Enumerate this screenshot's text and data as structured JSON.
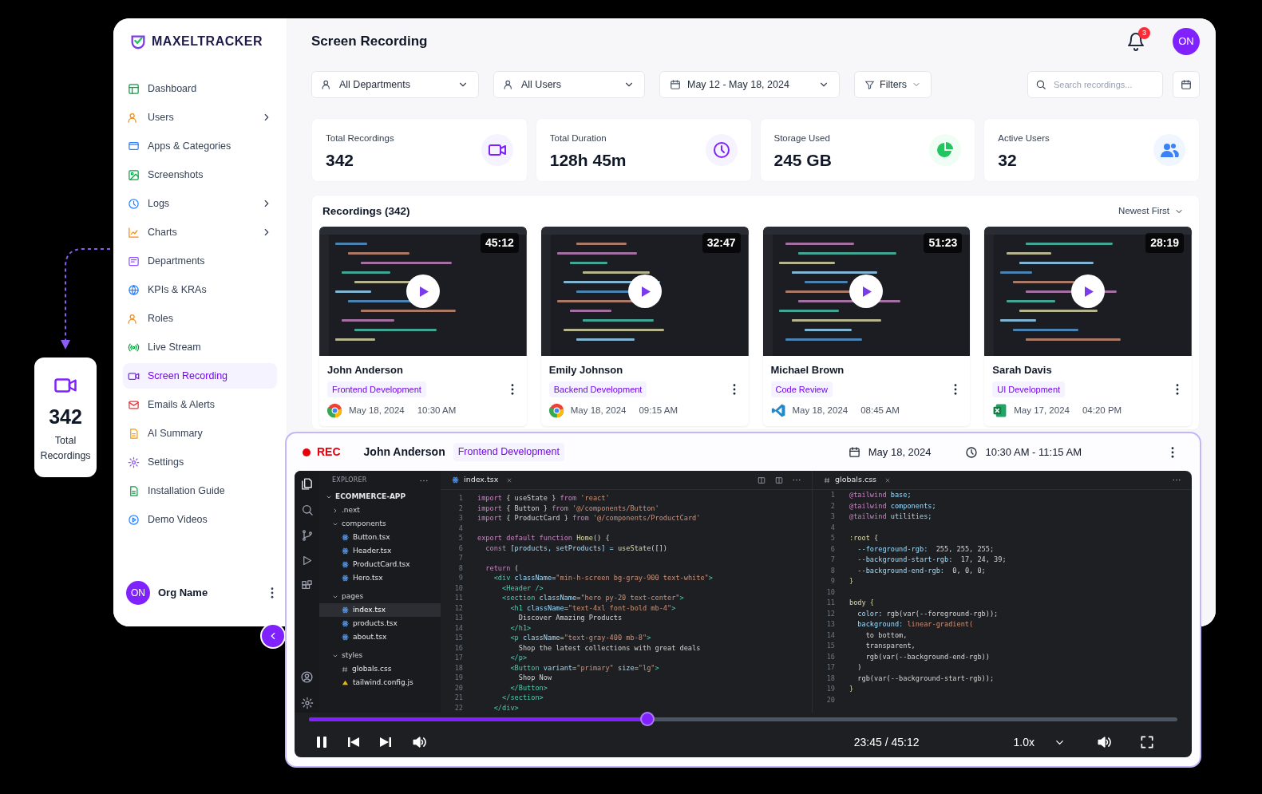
{
  "brand": "MAXELTRACKER",
  "sidebar": {
    "items": [
      {
        "label": "Dashboard",
        "has_submenu": false,
        "selected": false
      },
      {
        "label": "Users",
        "has_submenu": true,
        "selected": false
      },
      {
        "label": "Apps & Categories",
        "has_submenu": false,
        "selected": false
      },
      {
        "label": "Screenshots",
        "has_submenu": false,
        "selected": false
      },
      {
        "label": "Logs",
        "has_submenu": true,
        "selected": false
      },
      {
        "label": "Charts",
        "has_submenu": true,
        "selected": false
      },
      {
        "label": "Departments",
        "has_submenu": false,
        "selected": false
      },
      {
        "label": "KPIs & KRAs",
        "has_submenu": false,
        "selected": false
      },
      {
        "label": "Roles",
        "has_submenu": false,
        "selected": false
      },
      {
        "label": "Live Stream",
        "has_submenu": false,
        "selected": false
      },
      {
        "label": "Screen Recording",
        "has_submenu": false,
        "selected": true
      },
      {
        "label": "Emails & Alerts",
        "has_submenu": false,
        "selected": false
      },
      {
        "label": "AI Summary",
        "has_submenu": false,
        "selected": false
      },
      {
        "label": "Settings",
        "has_submenu": false,
        "selected": false
      },
      {
        "label": "Installation Guide",
        "has_submenu": false,
        "selected": false
      },
      {
        "label": "Demo Videos",
        "has_submenu": false,
        "selected": false
      }
    ],
    "org": {
      "initials": "ON",
      "name": "Org Name"
    }
  },
  "header": {
    "title": "Screen Recording",
    "notifications": "3",
    "avatar": "ON"
  },
  "filters": {
    "department": "All Departments",
    "user": "All Users",
    "date_range": "May 12 - May 18, 2024",
    "filters": "Filters",
    "search": {
      "placeholder": "Search recordings..."
    }
  },
  "stats": [
    {
      "label": "Total Recordings",
      "value": "342"
    },
    {
      "label": "Total Duration",
      "value": "128h 45m"
    },
    {
      "label": "Storage Used",
      "value": "245 GB"
    },
    {
      "label": "Active Users",
      "value": "32"
    }
  ],
  "recordings": {
    "title": "Recordings (342)",
    "sort": "Newest First",
    "items": [
      {
        "duration": "45:12",
        "name": "John Anderson",
        "tag": "Frontend Development",
        "date": "May 18, 2024",
        "time": "10:30 AM"
      },
      {
        "duration": "32:47",
        "name": "Emily Johnson",
        "tag": "Backend Development",
        "date": "May 18, 2024",
        "time": "09:15 AM"
      },
      {
        "duration": "51:23",
        "name": "Michael Brown",
        "tag": "Code Review",
        "date": "May 18, 2024",
        "time": "08:45 AM"
      },
      {
        "duration": "28:19",
        "name": "Sarah Davis",
        "tag": "UI Development",
        "date": "May 17, 2024",
        "time": "04:20 PM"
      }
    ]
  },
  "player": {
    "rec": "REC",
    "name": "John Anderson",
    "tag": "Frontend Development",
    "date": "May 18, 2024",
    "time_range": "10:30 AM - 11:15 AM",
    "explorer": {
      "title": "EXPLORER",
      "tree": [
        {
          "label": "ECOMMERCE-APP",
          "kind": "root",
          "expanded": true,
          "children": [
            {
              "label": ".next",
              "kind": "folder",
              "expanded": false
            },
            {
              "label": "components",
              "kind": "folder",
              "expanded": true,
              "children": [
                {
                  "label": "Button.tsx",
                  "kind": "tsx",
                  "selected": false
                },
                {
                  "label": "Header.tsx",
                  "kind": "tsx",
                  "selected": false
                },
                {
                  "label": "ProductCard.tsx",
                  "kind": "tsx",
                  "selected": false
                },
                {
                  "label": "Hero.tsx",
                  "kind": "tsx",
                  "selected": false
                }
              ]
            },
            {
              "label": "pages",
              "kind": "folder",
              "expanded": true,
              "children": [
                {
                  "label": "index.tsx",
                  "kind": "tsx",
                  "selected": true
                },
                {
                  "label": "products.tsx",
                  "kind": "tsx",
                  "selected": false
                },
                {
                  "label": "about.tsx",
                  "kind": "tsx",
                  "selected": false
                }
              ]
            },
            {
              "label": "styles",
              "kind": "folder",
              "expanded": true,
              "children": [
                {
                  "label": "globals.css",
                  "kind": "css",
                  "selected": false
                },
                {
                  "label": "tailwind.config.js",
                  "kind": "js",
                  "selected": false
                }
              ]
            }
          ]
        }
      ]
    },
    "panes": [
      {
        "tab": "index.tsx",
        "lines": [
          {
            "number": "1",
            "tokens": [
              {
                "text": "import ",
                "kind": "kw"
              },
              {
                "text": "{ useState } ",
                "kind": "tx"
              },
              {
                "text": "from ",
                "kind": "kw"
              },
              {
                "text": "'react'",
                "kind": "str"
              }
            ]
          },
          {
            "number": "2",
            "tokens": [
              {
                "text": "import ",
                "kind": "kw"
              },
              {
                "text": "{ Button } ",
                "kind": "tx"
              },
              {
                "text": "from ",
                "kind": "kw"
              },
              {
                "text": "'@/components/Button'",
                "kind": "str"
              }
            ]
          },
          {
            "number": "3",
            "tokens": [
              {
                "text": "import ",
                "kind": "kw"
              },
              {
                "text": "{ ProductCard } ",
                "kind": "tx"
              },
              {
                "text": "from ",
                "kind": "kw"
              },
              {
                "text": "'@/components/ProductCard'",
                "kind": "str"
              }
            ]
          },
          {
            "number": "4"
          },
          {
            "number": "5",
            "tokens": [
              {
                "text": "export default function ",
                "kind": "kw"
              },
              {
                "text": "Home",
                "kind": "fn"
              },
              {
                "text": "() {",
                "kind": "tx"
              }
            ]
          },
          {
            "number": "6",
            "tokens": [
              {
                "text": "  const ",
                "kind": "kw"
              },
              {
                "text": "[products, setProducts] = ",
                "kind": "attr"
              },
              {
                "text": "useState",
                "kind": "fn"
              },
              {
                "text": "([])",
                "kind": "tx"
              }
            ]
          },
          {
            "number": "7"
          },
          {
            "number": "8",
            "tokens": [
              {
                "text": "  return ",
                "kind": "kw"
              },
              {
                "text": "(",
                "kind": "tx"
              }
            ]
          },
          {
            "number": "9",
            "tokens": [
              {
                "text": "    <div ",
                "kind": "tag"
              },
              {
                "text": "className",
                "kind": "attr"
              },
              {
                "text": "=",
                "kind": "tx"
              },
              {
                "text": "\"min-h-screen bg-gray-900 text-white\"",
                "kind": "str"
              },
              {
                "text": ">",
                "kind": "tag"
              }
            ]
          },
          {
            "number": "10",
            "tokens": [
              {
                "text": "      <Header />",
                "kind": "tag"
              }
            ]
          },
          {
            "number": "11",
            "tokens": [
              {
                "text": "      <section ",
                "kind": "tag"
              },
              {
                "text": "className",
                "kind": "attr"
              },
              {
                "text": "=",
                "kind": "tx"
              },
              {
                "text": "\"hero py-20 text-center\"",
                "kind": "str"
              },
              {
                "text": ">",
                "kind": "tag"
              }
            ]
          },
          {
            "number": "12",
            "tokens": [
              {
                "text": "        <h1 ",
                "kind": "tag"
              },
              {
                "text": "className",
                "kind": "attr"
              },
              {
                "text": "=",
                "kind": "tx"
              },
              {
                "text": "\"text-4xl font-bold mb-4\"",
                "kind": "str"
              },
              {
                "text": ">",
                "kind": "tag"
              }
            ]
          },
          {
            "number": "13",
            "tokens": [
              {
                "text": "          Discover Amazing Products",
                "kind": "tx"
              }
            ]
          },
          {
            "number": "14",
            "tokens": [
              {
                "text": "        </h1>",
                "kind": "tag"
              }
            ]
          },
          {
            "number": "15",
            "tokens": [
              {
                "text": "        <p ",
                "kind": "tag"
              },
              {
                "text": "className",
                "kind": "attr"
              },
              {
                "text": "=",
                "kind": "tx"
              },
              {
                "text": "\"text-gray-400 mb-8\"",
                "kind": "str"
              },
              {
                "text": ">",
                "kind": "tag"
              }
            ]
          },
          {
            "number": "16",
            "tokens": [
              {
                "text": "          Shop the latest collections with great deals",
                "kind": "tx"
              }
            ]
          },
          {
            "number": "17",
            "tokens": [
              {
                "text": "        </p>",
                "kind": "tag"
              }
            ]
          },
          {
            "number": "18",
            "tokens": [
              {
                "text": "        <Button ",
                "kind": "tag"
              },
              {
                "text": "variant",
                "kind": "attr"
              },
              {
                "text": "=",
                "kind": "tx"
              },
              {
                "text": "\"primary\" ",
                "kind": "str"
              },
              {
                "text": "size",
                "kind": "attr"
              },
              {
                "text": "=",
                "kind": "tx"
              },
              {
                "text": "\"lg\"",
                "kind": "str"
              },
              {
                "text": ">",
                "kind": "tag"
              }
            ]
          },
          {
            "number": "19",
            "tokens": [
              {
                "text": "          Shop Now",
                "kind": "tx"
              }
            ]
          },
          {
            "number": "20",
            "tokens": [
              {
                "text": "        </Button>",
                "kind": "tag"
              }
            ]
          },
          {
            "number": "21",
            "tokens": [
              {
                "text": "      </section>",
                "kind": "tag"
              }
            ]
          },
          {
            "number": "22",
            "tokens": [
              {
                "text": "    </div>",
                "kind": "tag"
              }
            ]
          }
        ]
      },
      {
        "tab": "globals.css",
        "lines": [
          {
            "number": "1",
            "tokens": [
              {
                "text": "@tailwind ",
                "kind": "kw"
              },
              {
                "text": "base;",
                "kind": "attr"
              }
            ]
          },
          {
            "number": "2",
            "tokens": [
              {
                "text": "@tailwind ",
                "kind": "kw"
              },
              {
                "text": "components;",
                "kind": "attr"
              }
            ]
          },
          {
            "number": "3",
            "tokens": [
              {
                "text": "@tailwind ",
                "kind": "kw"
              },
              {
                "text": "utilities;",
                "kind": "attr"
              }
            ]
          },
          {
            "number": "4"
          },
          {
            "number": "5",
            "tokens": [
              {
                "text": ":root {",
                "kind": "fn"
              }
            ]
          },
          {
            "number": "6",
            "tokens": [
              {
                "text": "  --foreground-rgb: ",
                "kind": "attr"
              },
              {
                "text": " 255, 255, 255;",
                "kind": "tx"
              }
            ]
          },
          {
            "number": "7",
            "tokens": [
              {
                "text": "  --background-start-rgb: ",
                "kind": "attr"
              },
              {
                "text": " 17, 24, 39;",
                "kind": "tx"
              }
            ]
          },
          {
            "number": "8",
            "tokens": [
              {
                "text": "  --background-end-rgb: ",
                "kind": "attr"
              },
              {
                "text": " 0, 0, 0;",
                "kind": "tx"
              }
            ]
          },
          {
            "number": "9",
            "tokens": [
              {
                "text": "}",
                "kind": "fn"
              }
            ]
          },
          {
            "number": "10"
          },
          {
            "number": "11",
            "tokens": [
              {
                "text": "body {",
                "kind": "fn"
              }
            ]
          },
          {
            "number": "12",
            "tokens": [
              {
                "text": "  color: ",
                "kind": "attr"
              },
              {
                "text": "rgb(var(--foreground-rgb));",
                "kind": "tx"
              }
            ]
          },
          {
            "number": "13",
            "tokens": [
              {
                "text": "  background: ",
                "kind": "attr"
              },
              {
                "text": "linear-gradient(",
                "kind": "str"
              }
            ]
          },
          {
            "number": "14",
            "tokens": [
              {
                "text": "    to bottom,",
                "kind": "tx"
              }
            ]
          },
          {
            "number": "15",
            "tokens": [
              {
                "text": "    transparent,",
                "kind": "tx"
              }
            ]
          },
          {
            "number": "16",
            "tokens": [
              {
                "text": "    rgb(var(--background-end-rgb))",
                "kind": "tx"
              }
            ]
          },
          {
            "number": "17",
            "tokens": [
              {
                "text": "  )",
                "kind": "tx"
              }
            ]
          },
          {
            "number": "18",
            "tokens": [
              {
                "text": "  rgb(var(--background-start-rgb));",
                "kind": "tx"
              }
            ]
          },
          {
            "number": "19",
            "tokens": [
              {
                "text": "}",
                "kind": "fn"
              }
            ]
          },
          {
            "number": "20"
          }
        ]
      }
    ],
    "progress": {
      "level": 0.39
    },
    "time": "23:45 / 45:12",
    "speed": "1.0x"
  },
  "floating_card": {
    "value": "342",
    "label": "Total Recordings"
  }
}
